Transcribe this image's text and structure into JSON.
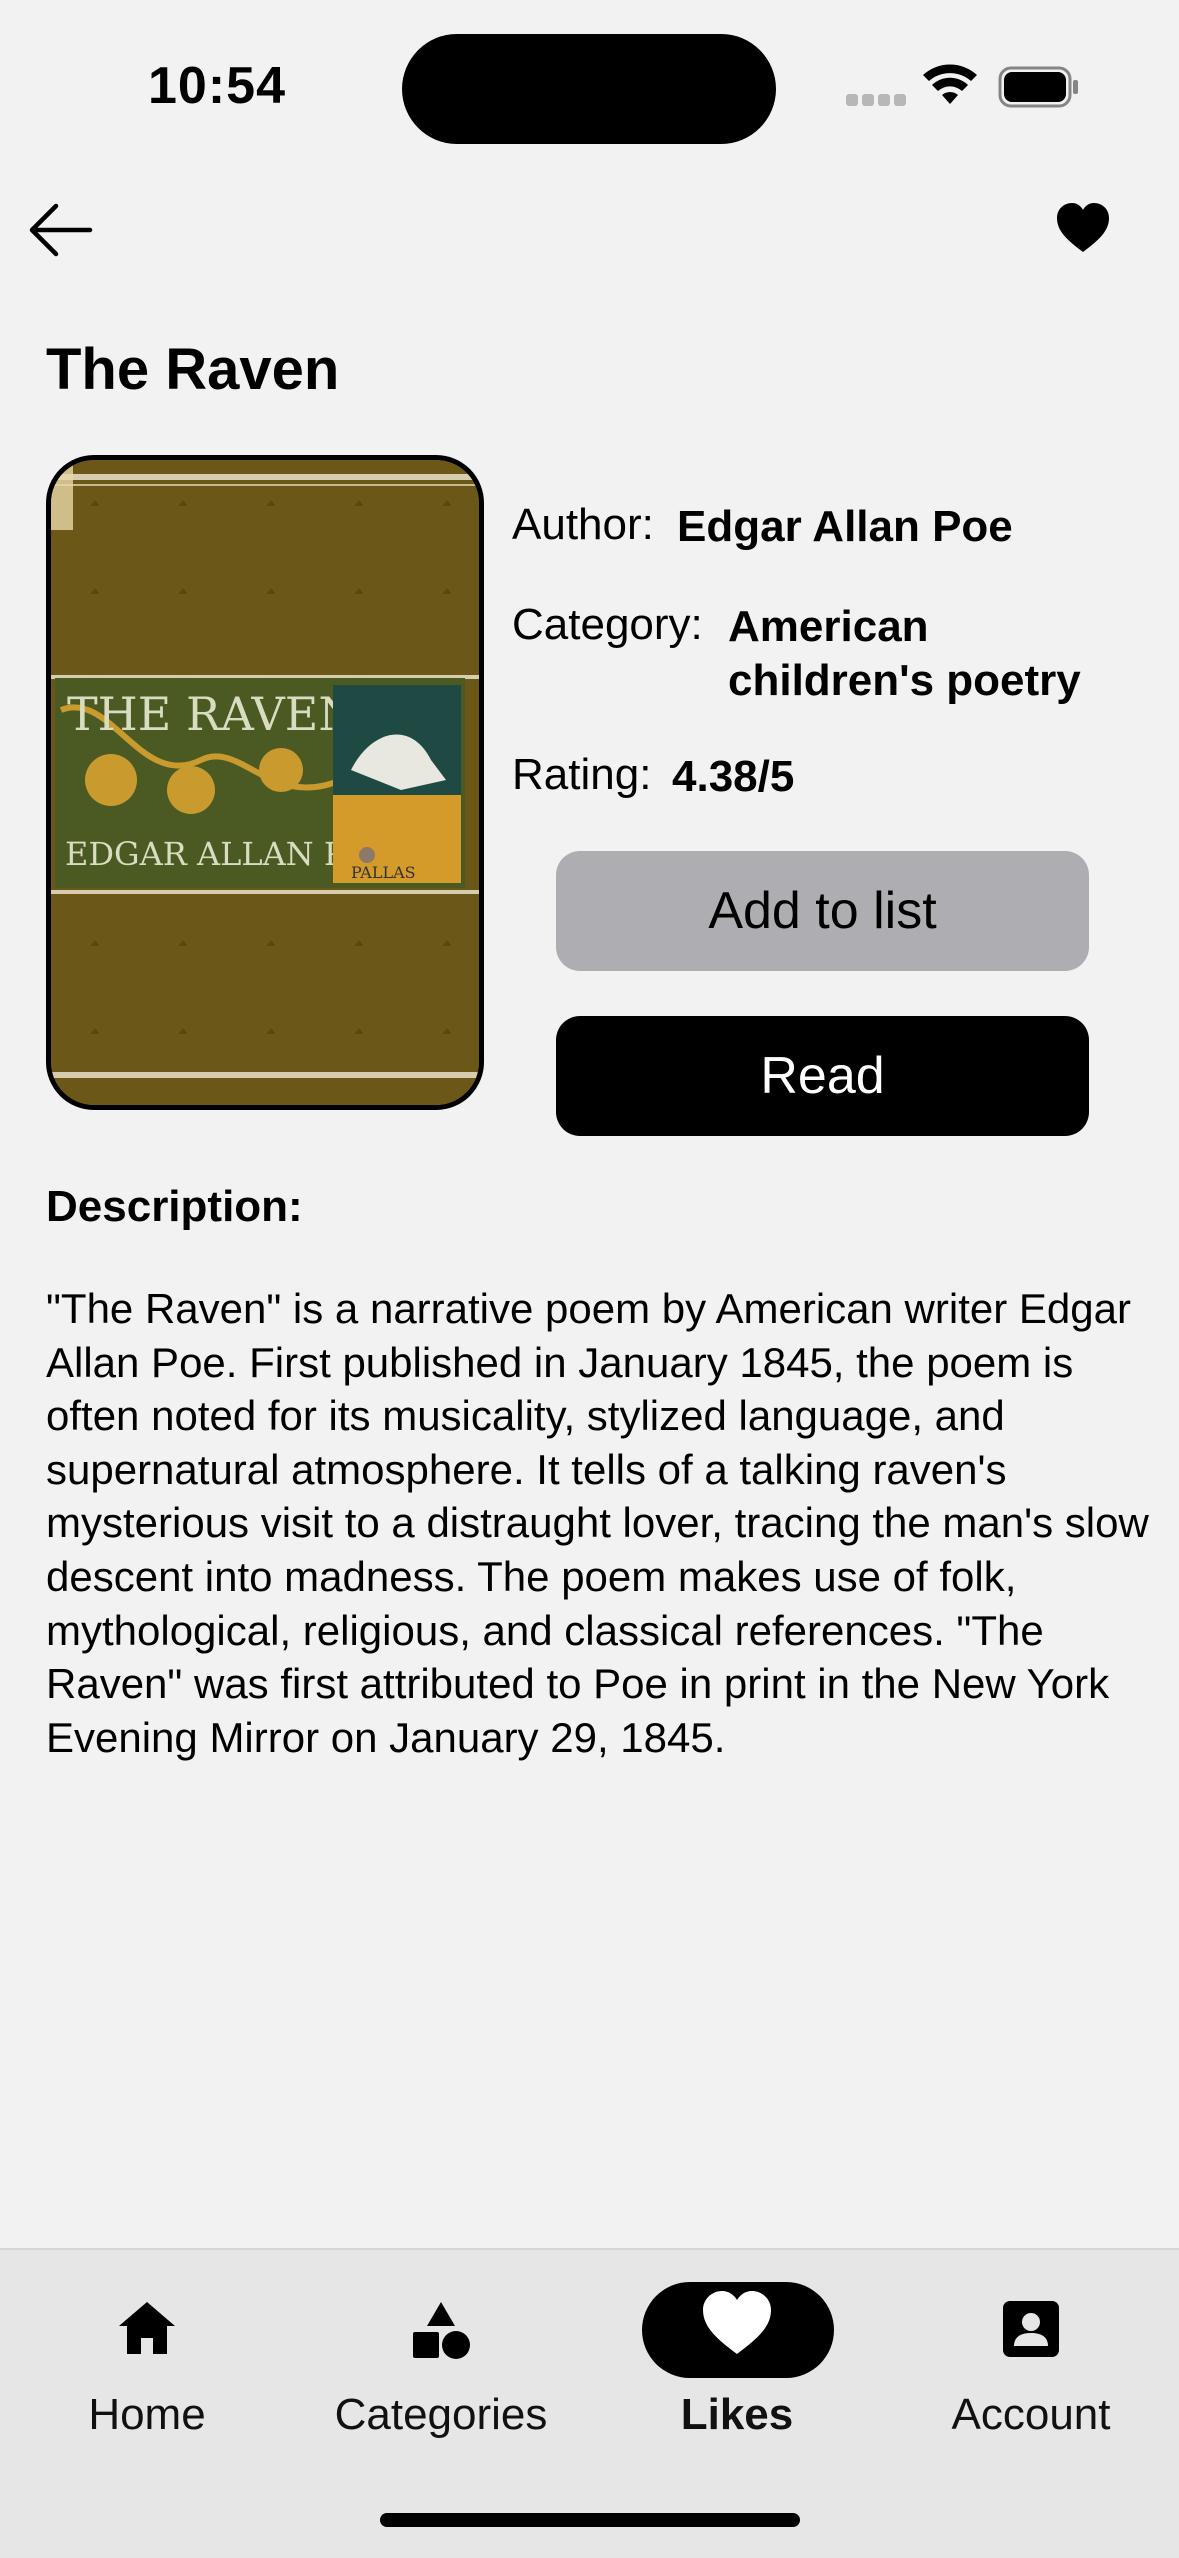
{
  "status_bar": {
    "time": "10:54"
  },
  "book": {
    "title": "The Raven",
    "author_label": "Author:",
    "author": "Edgar Allan Poe",
    "category_label": "Category:",
    "category_line1": "American",
    "category_line2": "children's poetry",
    "rating_label": "Rating:",
    "rating": "4.38/5",
    "cover_text": {
      "title": "THE RAVEN",
      "author": "EDGAR ALLAN POE",
      "emblem": "PALLAS"
    }
  },
  "actions": {
    "add_to_list": "Add to list",
    "read": "Read"
  },
  "description": {
    "heading": "Description:",
    "body": "\"The Raven\" is a narrative poem by American writer Edgar Allan Poe. First published in January 1845, the poem is often noted for its musicality, stylized language, and supernatural atmosphere. It tells of a talking raven's mysterious visit to a distraught lover, tracing the man's slow descent into madness. The poem makes use of folk, mythological, religious, and classical references. \"The Raven\" was first attributed to Poe in print in the New York Evening Mirror on January 29, 1845."
  },
  "tab_bar": {
    "items": [
      {
        "label": "Home",
        "icon": "home-icon"
      },
      {
        "label": "Categories",
        "icon": "shapes-icon"
      },
      {
        "label": "Likes",
        "icon": "heart-icon",
        "selected": true
      },
      {
        "label": "Account",
        "icon": "account-icon"
      }
    ]
  },
  "colors": {
    "background": "#f2f2f2",
    "primary": "#000000",
    "secondary_button": "#aeaeb2",
    "tab_bar": "#e6e6e6"
  }
}
